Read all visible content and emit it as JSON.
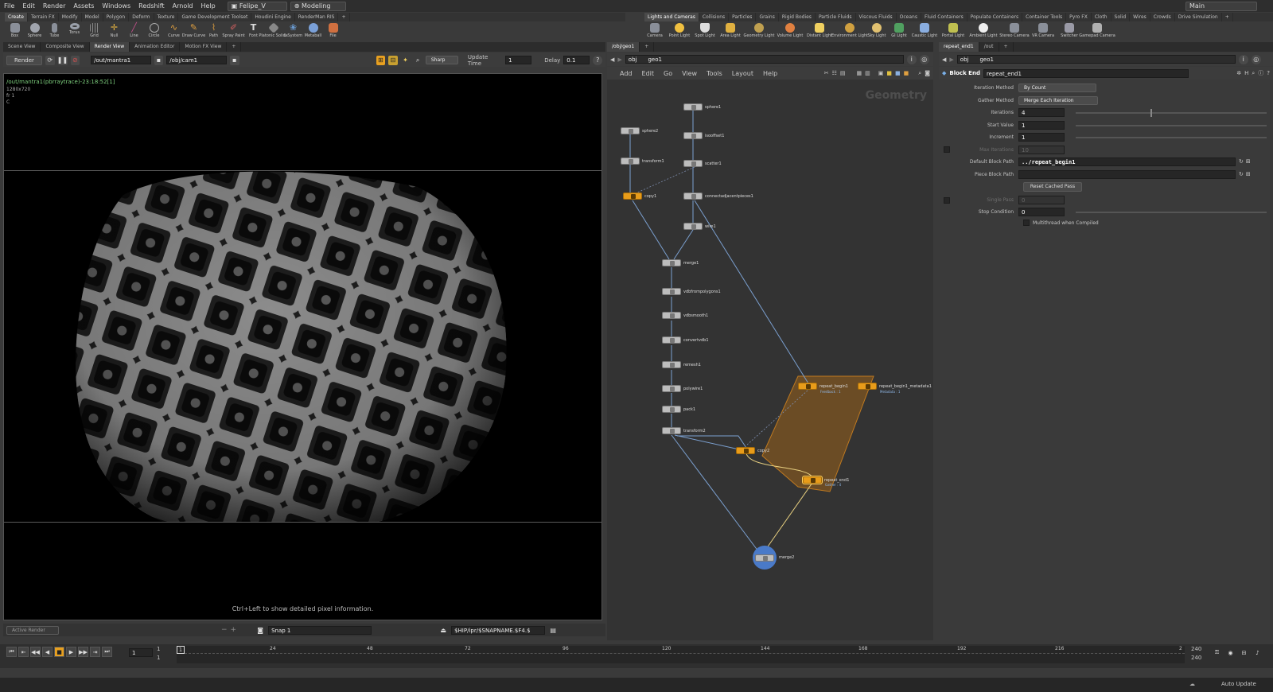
{
  "menubar": {
    "items": [
      "File",
      "Edit",
      "Render",
      "Assets",
      "Windows",
      "Redshift",
      "Arnold",
      "Help"
    ],
    "desktop": "Felipe_V",
    "context": "Modeling",
    "desktop_right": "Main"
  },
  "shelf_left": {
    "tabs": [
      "Create",
      "Terrain FX",
      "Modify",
      "Model",
      "Polygon",
      "Deform",
      "Texture",
      "Game Development Toolset",
      "Houdini Engine",
      "RenderMan RIS"
    ],
    "tools": [
      "Box",
      "Sphere",
      "Tube",
      "Torus",
      "Grid",
      "Null",
      "Line",
      "Circle",
      "Curve",
      "Draw Curve",
      "Path",
      "Spray Paint",
      "Font",
      "Platonic Solids",
      "L-System",
      "Metaball",
      "File"
    ]
  },
  "shelf_right": {
    "tabs": [
      "Lights and Cameras",
      "Collisions",
      "Particles",
      "Grains",
      "Rigid Bodies",
      "Particle Fluids",
      "Viscous Fluids",
      "Oceans",
      "Fluid Containers",
      "Populate Containers",
      "Container Tools",
      "Pyro FX",
      "Cloth",
      "Solid",
      "Wires",
      "Crowds",
      "Drive Simulation"
    ],
    "tools": [
      "Camera",
      "Point Light",
      "Spot Light",
      "Area Light",
      "Geometry Light",
      "Volume Light",
      "Distant Light",
      "Environment Light",
      "Sky Light",
      "GI Light",
      "Caustic Light",
      "Portal Light",
      "Ambient Light",
      "Stereo Camera",
      "VR Camera",
      "Switcher",
      "Gamepad Camera"
    ]
  },
  "render_pane": {
    "tabs": [
      "Scene View",
      "Composite View",
      "Render View",
      "Animation Editor",
      "Motion FX View"
    ],
    "active_tab": "Render View",
    "render_button": "Render",
    "rop_path": "/out/mantra1",
    "camera_path": "/obj/cam1",
    "sharp_label": "Sharp",
    "update_time_label": "Update Time",
    "update_time_value": "1",
    "delay_label": "Delay",
    "delay_value": "0.1",
    "overlay_line1": "/out/mantra1(pbrraytrace)-23:18:52[1]",
    "overlay_line2": "1280x720",
    "overlay_line3": "fr 1",
    "overlay_line4": "C",
    "hint": "Ctrl+Left to show detailed pixel information.",
    "active_render": "Active Render",
    "snap_label": "Snap 1",
    "output_path": "$HIP/ipr/$SNAPNAME.$F4.$"
  },
  "network_pane": {
    "tab": "/obj/geo1",
    "path_obj": "obj",
    "path_geo": "geo1",
    "menu": [
      "Add",
      "Edit",
      "Go",
      "View",
      "Tools",
      "Layout",
      "Help"
    ],
    "watermark": "Geometry",
    "nodes": {
      "sphere1": "sphere1",
      "sphere2": "sphere2",
      "isooffset1": "isooffset1",
      "transform1": "transform1",
      "scatter1": "scatter1",
      "copy1": "copy1",
      "connectadjacentpieces1": "connectadjacentpieces1",
      "wire1": "wire1",
      "merge1": "merge1",
      "vdbfrompolygons1": "vdbfrompolygons1",
      "vdbsmooth1": "vdbsmooth1",
      "convertvdb1": "convertvdb1",
      "remesh1": "remesh1",
      "polywire1": "polywire1",
      "pack1": "pack1",
      "transform2": "transform2",
      "repeat_begin1": "repeat_begin1",
      "repeat_begin1_sub": "Feedback : 1",
      "repeat_begin1_metadata1": "repeat_begin1_metadata1",
      "metadata_sub": "Metadata : 1",
      "copy2": "copy2",
      "repeat_end1": "repeat_end1",
      "repeat_end1_sub": "Gather : 4",
      "merge2": "merge2"
    }
  },
  "param_pane": {
    "tabs": [
      "repeat_end1",
      "/out"
    ],
    "path_obj": "obj",
    "path_geo": "geo1",
    "node_type": "Block End",
    "node_name": "repeat_end1",
    "iteration_method_label": "Iteration Method",
    "iteration_method_value": "By Count",
    "gather_method_label": "Gather Method",
    "gather_method_value": "Merge Each Iteration",
    "iterations_label": "Iterations",
    "iterations_value": "4",
    "start_value_label": "Start Value",
    "start_value_value": "1",
    "increment_label": "Increment",
    "increment_value": "1",
    "max_iterations_label": "Max Iterations",
    "max_iterations_value": "10",
    "default_block_path_label": "Default Block Path",
    "default_block_path_value": "../repeat_begin1",
    "piece_block_path_label": "Piece Block Path",
    "piece_block_path_value": "",
    "reset_cached_pass": "Reset Cached Pass",
    "single_pass_label": "Single Pass",
    "single_pass_value": "0",
    "stop_condition_label": "Stop Condition",
    "stop_condition_value": "0",
    "multithread_label": "Multithread when Compiled"
  },
  "timeline": {
    "current_frame": "1",
    "start_frame": "1",
    "start_frame2": "1",
    "ticks": [
      "1",
      "24",
      "48",
      "72",
      "96",
      "120",
      "144",
      "168",
      "192",
      "216",
      "2"
    ],
    "end_frame": "240",
    "end_frame2": "240"
  },
  "status": {
    "auto_update": "Auto Update"
  }
}
